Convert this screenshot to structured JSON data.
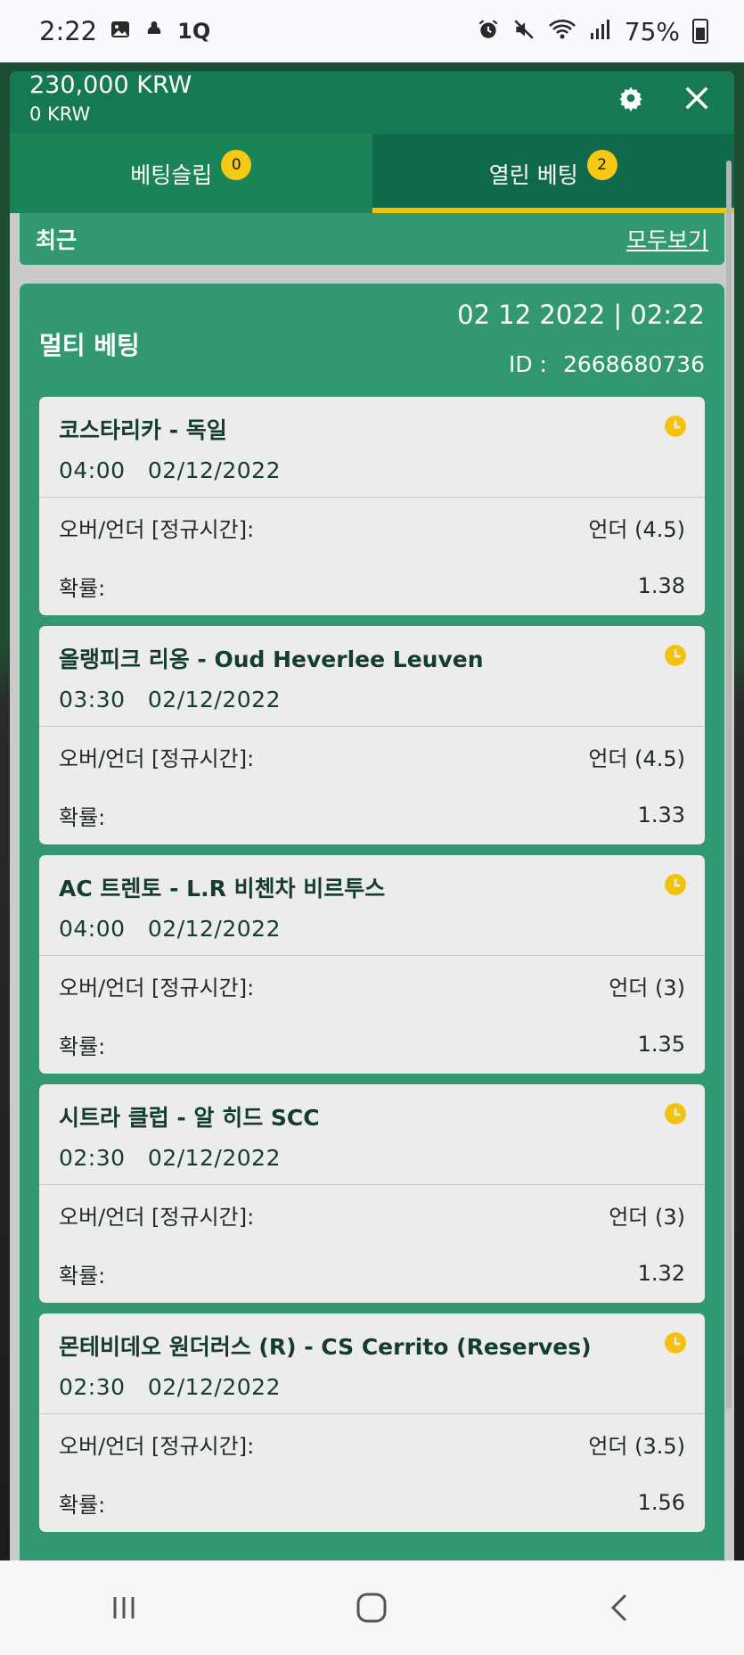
{
  "status_bar": {
    "time": "2:22",
    "extra_glyph": "1Q",
    "battery": "75%"
  },
  "header": {
    "balance": "230,000 KRW",
    "sub_balance": "0 KRW"
  },
  "tabs": [
    {
      "label": "베팅슬립",
      "badge": "0"
    },
    {
      "label": "열린 베팅",
      "badge": "2"
    }
  ],
  "recent": {
    "title": "최근",
    "view_all": "모두보기"
  },
  "multi_bet": {
    "title": "멀티 베팅",
    "datetime": "02 12 2022 | 02:22",
    "id_label": "ID :",
    "id_value": "2668680736",
    "selections": [
      {
        "match": "코스타리카 - 독일",
        "time": "04:00",
        "date": "02/12/2022",
        "market": "오버/언더 [정규시간]:",
        "pick": "언더 (4.5)",
        "odds_label": "확률:",
        "odds": "1.38"
      },
      {
        "match": "올랭피크 리옹 - Oud Heverlee Leuven",
        "time": "03:30",
        "date": "02/12/2022",
        "market": "오버/언더 [정규시간]:",
        "pick": "언더 (4.5)",
        "odds_label": "확률:",
        "odds": "1.33"
      },
      {
        "match": "AC 트렌토 - L.R 비첸차 비르투스",
        "time": "04:00",
        "date": "02/12/2022",
        "market": "오버/언더 [정규시간]:",
        "pick": "언더 (3)",
        "odds_label": "확률:",
        "odds": "1.35"
      },
      {
        "match": "시트라 클럽 - 알 히드 SCC",
        "time": "02:30",
        "date": "02/12/2022",
        "market": "오버/언더 [정규시간]:",
        "pick": "언더 (3)",
        "odds_label": "확률:",
        "odds": "1.32"
      },
      {
        "match": "몬테비데오 원더러스 (R) - CS Cerrito (Reserves)",
        "time": "02:30",
        "date": "02/12/2022",
        "market": "오버/언더 [정규시간]:",
        "pick": "언더 (3.5)",
        "odds_label": "확률:",
        "odds": "1.56"
      }
    ]
  },
  "colors": {
    "primary_green": "#157a54",
    "panel_green": "#329872",
    "accent_yellow": "#f6c915"
  },
  "icons": [
    "gallery-icon",
    "notification-icon",
    "alarm-icon",
    "mute-icon",
    "wifi-icon",
    "signal-icon",
    "battery-icon",
    "gear-icon",
    "close-icon",
    "clock-icon",
    "recents-icon",
    "home-icon",
    "back-icon"
  ]
}
